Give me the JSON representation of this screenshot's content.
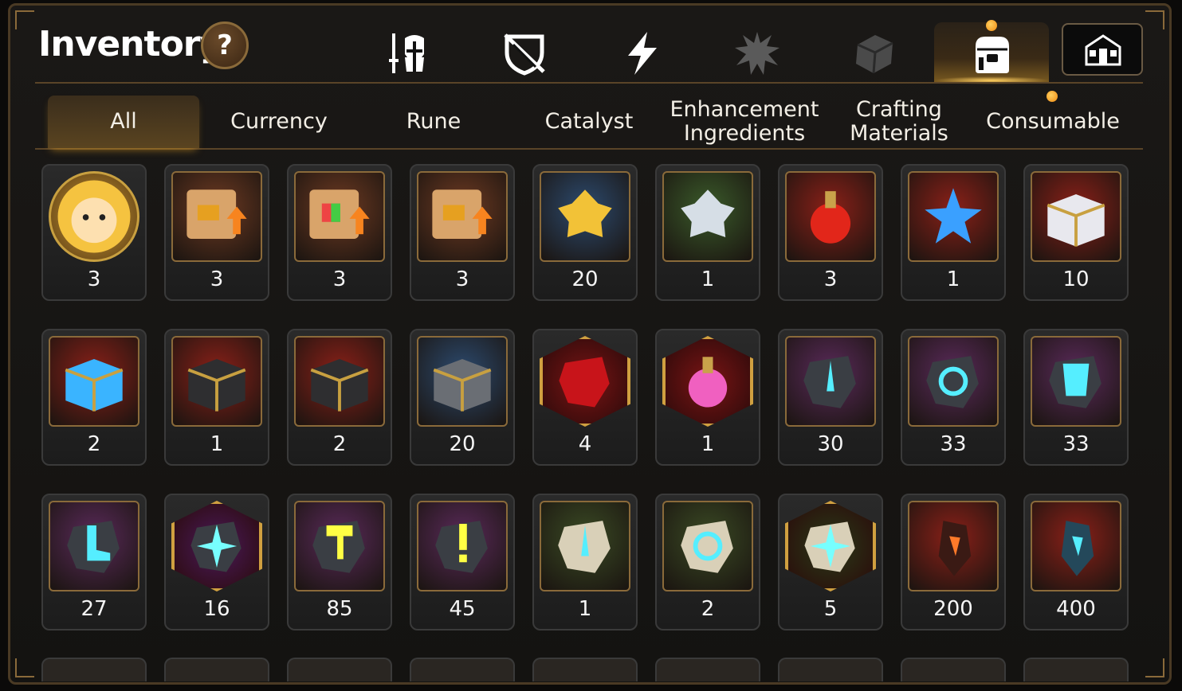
{
  "header": {
    "title": "Inventory",
    "help_label": "?"
  },
  "category_icons": [
    {
      "name": "equipment-icon"
    },
    {
      "name": "broken-shield-icon"
    },
    {
      "name": "lightning-icon"
    },
    {
      "name": "burst-icon"
    },
    {
      "name": "crystal-cube-icon"
    },
    {
      "name": "bag-icon",
      "active": true
    }
  ],
  "castle_button_icon": "castle-icon",
  "tabs": [
    {
      "label": "All",
      "active": true
    },
    {
      "label": "Currency"
    },
    {
      "label": "Rune"
    },
    {
      "label": "Catalyst"
    },
    {
      "label": "Enhancement Ingredients",
      "line1": "Enhancement",
      "line2": "Ingredients"
    },
    {
      "label": "Crafting Materials",
      "line1": "Crafting",
      "line2": "Materials"
    },
    {
      "label": "Consumable"
    }
  ],
  "items": [
    {
      "name": "chick-portrait-icon",
      "qty": "3",
      "bg": "#c89a3a",
      "shape": "round"
    },
    {
      "name": "upgrade-scroll-icon",
      "qty": "3",
      "bg": "#6e3a22"
    },
    {
      "name": "rainbow-scroll-icon",
      "qty": "3",
      "bg": "#6e3a22"
    },
    {
      "name": "gold-scroll-icon",
      "qty": "3",
      "bg": "#6e3a22"
    },
    {
      "name": "gold-crystal-icon",
      "qty": "20",
      "bg": "#2c4a6e"
    },
    {
      "name": "silver-crystal-icon",
      "qty": "1",
      "bg": "#3a5a2a"
    },
    {
      "name": "red-potion-icon",
      "qty": "3",
      "bg": "#8a2018"
    },
    {
      "name": "star-potion-icon",
      "qty": "1",
      "bg": "#8a2018"
    },
    {
      "name": "silver-chest-icon",
      "qty": "10",
      "bg": "#8a2018"
    },
    {
      "name": "blue-chest-icon",
      "qty": "2",
      "bg": "#8a2018"
    },
    {
      "name": "dark-chest-icon",
      "qty": "1",
      "bg": "#8a2018"
    },
    {
      "name": "dark-chest-icon",
      "qty": "2",
      "bg": "#8a2018"
    },
    {
      "name": "iron-box-icon",
      "qty": "20",
      "bg": "#2c4a6e"
    },
    {
      "name": "red-rune-stone-icon",
      "qty": "4",
      "bg": "#7a1414",
      "shape": "hex"
    },
    {
      "name": "pink-potion-icon",
      "qty": "1",
      "bg": "#7a1414",
      "shape": "hex"
    },
    {
      "name": "sword-rune-icon",
      "qty": "30",
      "bg": "#5a2a5a"
    },
    {
      "name": "spiral-rune-icon",
      "qty": "33",
      "bg": "#5a2a5a"
    },
    {
      "name": "armor-rune-icon",
      "qty": "33",
      "bg": "#5a2a5a"
    },
    {
      "name": "boot-rune-icon",
      "qty": "27",
      "bg": "#5a2a5a"
    },
    {
      "name": "star-rune-icon",
      "qty": "16",
      "bg": "#4a1a5a",
      "shape": "hex"
    },
    {
      "name": "hammer-rune-icon",
      "qty": "85",
      "bg": "#5a2a5a"
    },
    {
      "name": "exclaim-rune-icon",
      "qty": "45",
      "bg": "#5a2a5a"
    },
    {
      "name": "sword-stone-icon",
      "qty": "1",
      "bg": "#3a4a24"
    },
    {
      "name": "spiral-stone-icon",
      "qty": "2",
      "bg": "#3a4a24"
    },
    {
      "name": "star-stone-icon",
      "qty": "5",
      "bg": "#2a3a18",
      "shape": "hex"
    },
    {
      "name": "ember-shard-icon",
      "qty": "200",
      "bg": "#8a2018"
    },
    {
      "name": "blue-shard-icon",
      "qty": "400",
      "bg": "#8a2018"
    }
  ]
}
